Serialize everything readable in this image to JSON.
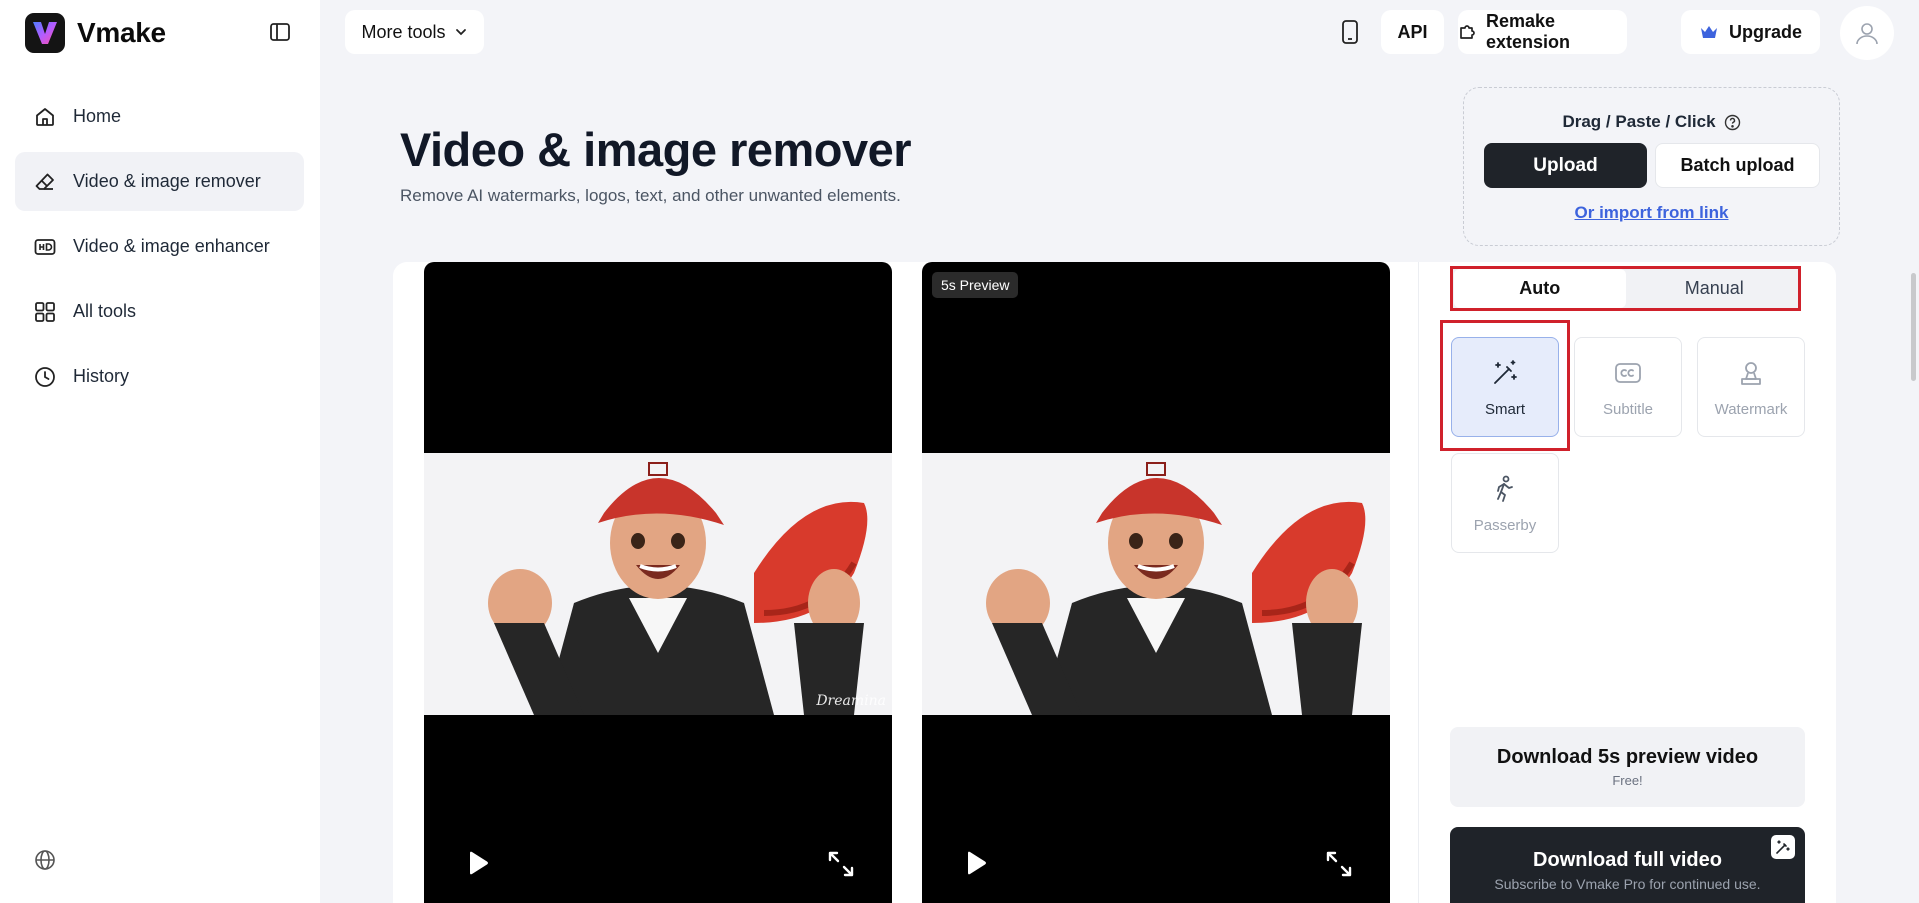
{
  "brand": {
    "name": "Vmake"
  },
  "sidebar": {
    "items": [
      {
        "label": "Home",
        "icon": "home-icon",
        "active": false
      },
      {
        "label": "Video & image remover",
        "icon": "eraser-icon",
        "active": true
      },
      {
        "label": "Video & image enhancer",
        "icon": "hd-icon",
        "active": false
      },
      {
        "label": "All tools",
        "icon": "grid-icon",
        "active": false
      },
      {
        "label": "History",
        "icon": "clock-icon",
        "active": false
      }
    ]
  },
  "topbar": {
    "more_tools": "More tools",
    "api": "API",
    "remake_extension": "Remake extension",
    "upgrade": "Upgrade"
  },
  "header": {
    "title": "Video & image remover",
    "subtitle": "Remove AI watermarks, logos, text, and other unwanted elements."
  },
  "upload": {
    "drag_text": "Drag / Paste / Click",
    "upload_label": "Upload",
    "batch_label": "Batch upload",
    "import_link": "Or import from link"
  },
  "preview": {
    "badge": "5s Preview",
    "watermark_text": "Dreamina"
  },
  "modes": {
    "tabs": [
      {
        "label": "Auto",
        "active": true
      },
      {
        "label": "Manual",
        "active": false
      }
    ]
  },
  "tools": [
    {
      "label": "Smart",
      "icon": "magic-wand-icon",
      "selected": true
    },
    {
      "label": "Subtitle",
      "icon": "cc-icon",
      "selected": false
    },
    {
      "label": "Watermark",
      "icon": "watermark-icon",
      "selected": false
    },
    {
      "label": "Passerby",
      "icon": "walking-person-icon",
      "selected": false
    }
  ],
  "download": {
    "preview_title": "Download 5s preview video",
    "preview_sub": "Free!",
    "full_title": "Download full video",
    "full_sub": "Subscribe to Vmake Pro for continued use."
  },
  "colors": {
    "accent": "#3d63dd",
    "dark": "#1f2329",
    "highlight": "#d0212b",
    "selected_bg": "#e6ecfb"
  }
}
